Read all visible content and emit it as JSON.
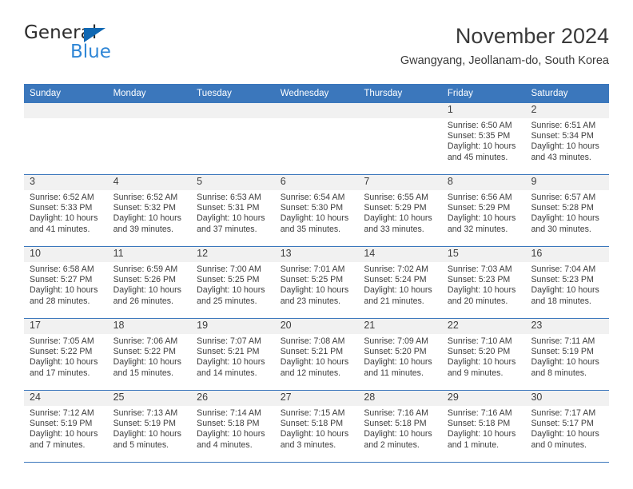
{
  "brand": {
    "name_top": "General",
    "name_bottom": "Blue",
    "triangle_icon": "brand-triangle-icon",
    "color_dark": "#2b2b2b",
    "color_blue": "#2f86d6",
    "color_triangle": "#1068b3"
  },
  "header": {
    "title": "November 2024",
    "subtitle": "Gwangyang, Jeollanam-do, South Korea"
  },
  "theme": {
    "header_blue": "#3b77bc",
    "daynum_band": "#f1f1f1",
    "text": "#3d3d3d"
  },
  "weekdays": [
    "Sunday",
    "Monday",
    "Tuesday",
    "Wednesday",
    "Thursday",
    "Friday",
    "Saturday"
  ],
  "labels": {
    "sunrise": "Sunrise:",
    "sunset": "Sunset:",
    "daylight": "Daylight:"
  },
  "weeks": [
    [
      {
        "day": "",
        "empty": true
      },
      {
        "day": "",
        "empty": true
      },
      {
        "day": "",
        "empty": true
      },
      {
        "day": "",
        "empty": true
      },
      {
        "day": "",
        "empty": true
      },
      {
        "day": "1",
        "sunrise": "Sunrise: 6:50 AM",
        "sunset": "Sunset: 5:35 PM",
        "daylight_1": "Daylight: 10 hours",
        "daylight_2": "and 45 minutes."
      },
      {
        "day": "2",
        "sunrise": "Sunrise: 6:51 AM",
        "sunset": "Sunset: 5:34 PM",
        "daylight_1": "Daylight: 10 hours",
        "daylight_2": "and 43 minutes."
      }
    ],
    [
      {
        "day": "3",
        "sunrise": "Sunrise: 6:52 AM",
        "sunset": "Sunset: 5:33 PM",
        "daylight_1": "Daylight: 10 hours",
        "daylight_2": "and 41 minutes."
      },
      {
        "day": "4",
        "sunrise": "Sunrise: 6:52 AM",
        "sunset": "Sunset: 5:32 PM",
        "daylight_1": "Daylight: 10 hours",
        "daylight_2": "and 39 minutes."
      },
      {
        "day": "5",
        "sunrise": "Sunrise: 6:53 AM",
        "sunset": "Sunset: 5:31 PM",
        "daylight_1": "Daylight: 10 hours",
        "daylight_2": "and 37 minutes."
      },
      {
        "day": "6",
        "sunrise": "Sunrise: 6:54 AM",
        "sunset": "Sunset: 5:30 PM",
        "daylight_1": "Daylight: 10 hours",
        "daylight_2": "and 35 minutes."
      },
      {
        "day": "7",
        "sunrise": "Sunrise: 6:55 AM",
        "sunset": "Sunset: 5:29 PM",
        "daylight_1": "Daylight: 10 hours",
        "daylight_2": "and 33 minutes."
      },
      {
        "day": "8",
        "sunrise": "Sunrise: 6:56 AM",
        "sunset": "Sunset: 5:29 PM",
        "daylight_1": "Daylight: 10 hours",
        "daylight_2": "and 32 minutes."
      },
      {
        "day": "9",
        "sunrise": "Sunrise: 6:57 AM",
        "sunset": "Sunset: 5:28 PM",
        "daylight_1": "Daylight: 10 hours",
        "daylight_2": "and 30 minutes."
      }
    ],
    [
      {
        "day": "10",
        "sunrise": "Sunrise: 6:58 AM",
        "sunset": "Sunset: 5:27 PM",
        "daylight_1": "Daylight: 10 hours",
        "daylight_2": "and 28 minutes."
      },
      {
        "day": "11",
        "sunrise": "Sunrise: 6:59 AM",
        "sunset": "Sunset: 5:26 PM",
        "daylight_1": "Daylight: 10 hours",
        "daylight_2": "and 26 minutes."
      },
      {
        "day": "12",
        "sunrise": "Sunrise: 7:00 AM",
        "sunset": "Sunset: 5:25 PM",
        "daylight_1": "Daylight: 10 hours",
        "daylight_2": "and 25 minutes."
      },
      {
        "day": "13",
        "sunrise": "Sunrise: 7:01 AM",
        "sunset": "Sunset: 5:25 PM",
        "daylight_1": "Daylight: 10 hours",
        "daylight_2": "and 23 minutes."
      },
      {
        "day": "14",
        "sunrise": "Sunrise: 7:02 AM",
        "sunset": "Sunset: 5:24 PM",
        "daylight_1": "Daylight: 10 hours",
        "daylight_2": "and 21 minutes."
      },
      {
        "day": "15",
        "sunrise": "Sunrise: 7:03 AM",
        "sunset": "Sunset: 5:23 PM",
        "daylight_1": "Daylight: 10 hours",
        "daylight_2": "and 20 minutes."
      },
      {
        "day": "16",
        "sunrise": "Sunrise: 7:04 AM",
        "sunset": "Sunset: 5:23 PM",
        "daylight_1": "Daylight: 10 hours",
        "daylight_2": "and 18 minutes."
      }
    ],
    [
      {
        "day": "17",
        "sunrise": "Sunrise: 7:05 AM",
        "sunset": "Sunset: 5:22 PM",
        "daylight_1": "Daylight: 10 hours",
        "daylight_2": "and 17 minutes."
      },
      {
        "day": "18",
        "sunrise": "Sunrise: 7:06 AM",
        "sunset": "Sunset: 5:22 PM",
        "daylight_1": "Daylight: 10 hours",
        "daylight_2": "and 15 minutes."
      },
      {
        "day": "19",
        "sunrise": "Sunrise: 7:07 AM",
        "sunset": "Sunset: 5:21 PM",
        "daylight_1": "Daylight: 10 hours",
        "daylight_2": "and 14 minutes."
      },
      {
        "day": "20",
        "sunrise": "Sunrise: 7:08 AM",
        "sunset": "Sunset: 5:21 PM",
        "daylight_1": "Daylight: 10 hours",
        "daylight_2": "and 12 minutes."
      },
      {
        "day": "21",
        "sunrise": "Sunrise: 7:09 AM",
        "sunset": "Sunset: 5:20 PM",
        "daylight_1": "Daylight: 10 hours",
        "daylight_2": "and 11 minutes."
      },
      {
        "day": "22",
        "sunrise": "Sunrise: 7:10 AM",
        "sunset": "Sunset: 5:20 PM",
        "daylight_1": "Daylight: 10 hours",
        "daylight_2": "and 9 minutes."
      },
      {
        "day": "23",
        "sunrise": "Sunrise: 7:11 AM",
        "sunset": "Sunset: 5:19 PM",
        "daylight_1": "Daylight: 10 hours",
        "daylight_2": "and 8 minutes."
      }
    ],
    [
      {
        "day": "24",
        "sunrise": "Sunrise: 7:12 AM",
        "sunset": "Sunset: 5:19 PM",
        "daylight_1": "Daylight: 10 hours",
        "daylight_2": "and 7 minutes."
      },
      {
        "day": "25",
        "sunrise": "Sunrise: 7:13 AM",
        "sunset": "Sunset: 5:19 PM",
        "daylight_1": "Daylight: 10 hours",
        "daylight_2": "and 5 minutes."
      },
      {
        "day": "26",
        "sunrise": "Sunrise: 7:14 AM",
        "sunset": "Sunset: 5:18 PM",
        "daylight_1": "Daylight: 10 hours",
        "daylight_2": "and 4 minutes."
      },
      {
        "day": "27",
        "sunrise": "Sunrise: 7:15 AM",
        "sunset": "Sunset: 5:18 PM",
        "daylight_1": "Daylight: 10 hours",
        "daylight_2": "and 3 minutes."
      },
      {
        "day": "28",
        "sunrise": "Sunrise: 7:16 AM",
        "sunset": "Sunset: 5:18 PM",
        "daylight_1": "Daylight: 10 hours",
        "daylight_2": "and 2 minutes."
      },
      {
        "day": "29",
        "sunrise": "Sunrise: 7:16 AM",
        "sunset": "Sunset: 5:18 PM",
        "daylight_1": "Daylight: 10 hours",
        "daylight_2": "and 1 minute."
      },
      {
        "day": "30",
        "sunrise": "Sunrise: 7:17 AM",
        "sunset": "Sunset: 5:17 PM",
        "daylight_1": "Daylight: 10 hours",
        "daylight_2": "and 0 minutes."
      }
    ]
  ]
}
